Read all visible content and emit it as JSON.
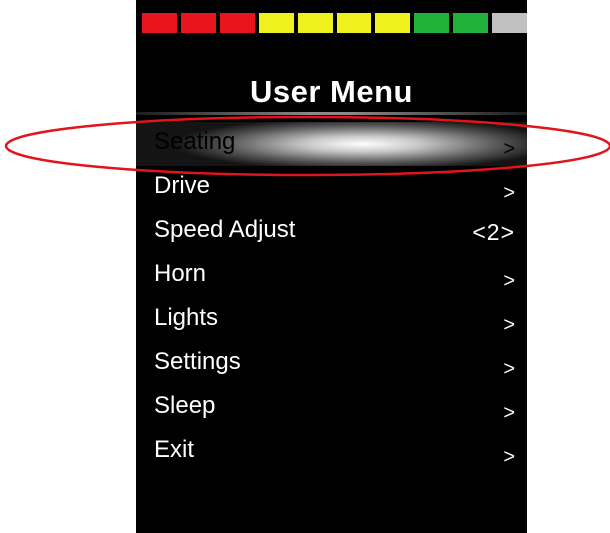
{
  "battery": {
    "segments": [
      {
        "color": "#e8161c"
      },
      {
        "color": "#e8161c"
      },
      {
        "color": "#e8161c"
      },
      {
        "color": "#f0f01e"
      },
      {
        "color": "#f0f01e"
      },
      {
        "color": "#f0f01e"
      },
      {
        "color": "#f0f01e"
      },
      {
        "color": "#1fb13a"
      },
      {
        "color": "#1fb13a"
      },
      {
        "color": "#c0c0c0"
      }
    ]
  },
  "header": {
    "title": "User Menu"
  },
  "menu": {
    "items": [
      {
        "label": "Seating",
        "indicator": ">",
        "selected": true
      },
      {
        "label": "Drive",
        "indicator": ">"
      },
      {
        "label": "Speed Adjust",
        "indicator": "<2>"
      },
      {
        "label": "Horn",
        "indicator": ">"
      },
      {
        "label": "Lights",
        "indicator": ">"
      },
      {
        "label": "Settings",
        "indicator": ">"
      },
      {
        "label": "Sleep",
        "indicator": ">"
      },
      {
        "label": "Exit",
        "indicator": ">"
      }
    ]
  },
  "annotation": {
    "color": "#e0141a"
  }
}
